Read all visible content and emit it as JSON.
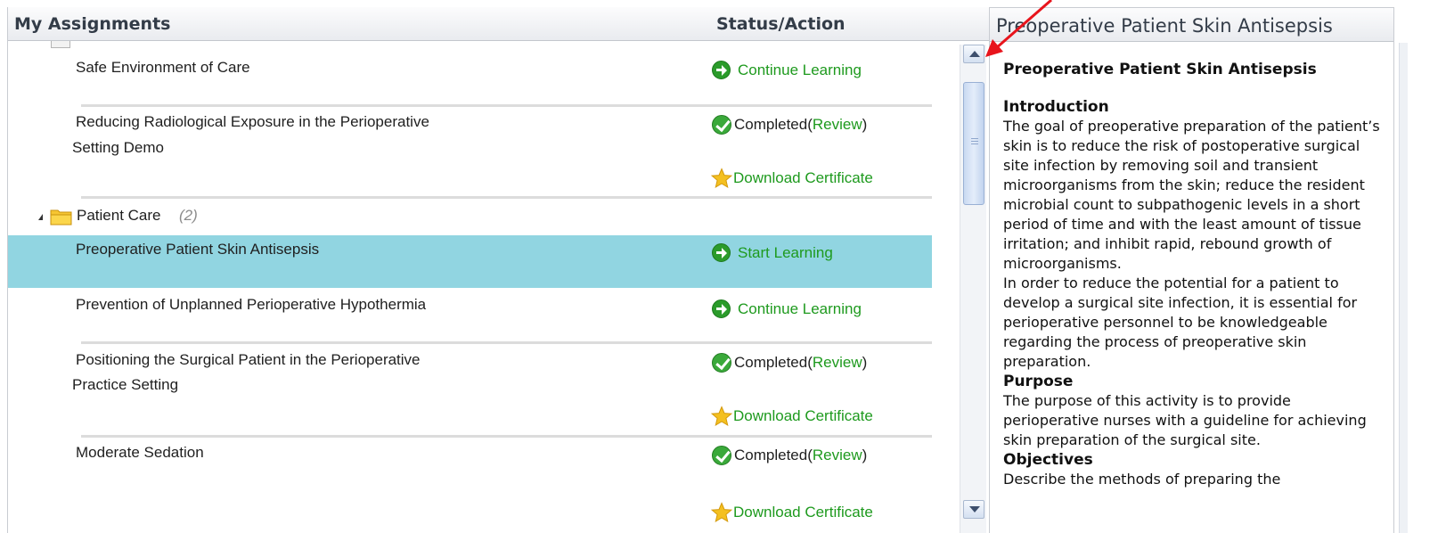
{
  "header": {
    "my_assignments": "My Assignments",
    "status_action": "Status/Action"
  },
  "rows": [
    {
      "title_lines": [
        "Safe Environment of Care"
      ],
      "action": "continue",
      "action_label": "Continue Learning"
    },
    {
      "title_lines": [
        "Reducing Radiological Exposure in the Perioperative",
        "Setting Demo"
      ],
      "action": "completed",
      "completed_label": "Completed(",
      "review_label": "Review",
      "close_paren": ")",
      "certificate_label": "Download Certificate"
    },
    {
      "title_lines": [
        "Preoperative Patient Skin Antisepsis"
      ],
      "action": "start",
      "action_label": "Start Learning",
      "selected": true
    },
    {
      "title_lines": [
        "Prevention of Unplanned Perioperative Hypothermia"
      ],
      "action": "continue",
      "action_label": "Continue Learning"
    },
    {
      "title_lines": [
        "Positioning the Surgical Patient in the Perioperative",
        "Practice Setting"
      ],
      "action": "completed",
      "completed_label": "Completed(",
      "review_label": "Review",
      "close_paren": ")",
      "certificate_label": "Download Certificate"
    },
    {
      "title_lines": [
        "Moderate Sedation"
      ],
      "action": "completed",
      "completed_label": "Completed(",
      "review_label": "Review",
      "close_paren": ")",
      "certificate_label": "Download Certificate"
    }
  ],
  "folder": {
    "label": "Patient Care",
    "count": "(2)"
  },
  "detail": {
    "header": "Preoperative Patient Skin Antisepsis",
    "title": "Preoperative Patient Skin Antisepsis",
    "intro_heading": "Introduction",
    "intro_text_1": "The goal of preoperative preparation of the patient’s skin is to reduce the risk of postoperative surgical site infection by removing soil and transient microorganisms from the skin; reduce the resident microbial count to subpathogenic levels in a short period of time and with the least amount of tissue irritation; and inhibit rapid, rebound growth of microorganisms.",
    "intro_text_2": "In order to reduce the potential for a patient to develop a surgical site infection, it is essential for perioperative personnel to be knowledgeable regarding the process of preoperative skin preparation.",
    "purpose_heading": "Purpose",
    "purpose_text": "The purpose of this activity is to provide perioperative nurses with a guideline for achieving skin preparation of the surgical site.",
    "objectives_heading": "Objectives",
    "objectives_text": "Describe the methods of preparing the"
  },
  "colors": {
    "selected_row": "#91d5e1",
    "link_green": "#1e9a1e",
    "annotation_red": "#e8141c"
  }
}
